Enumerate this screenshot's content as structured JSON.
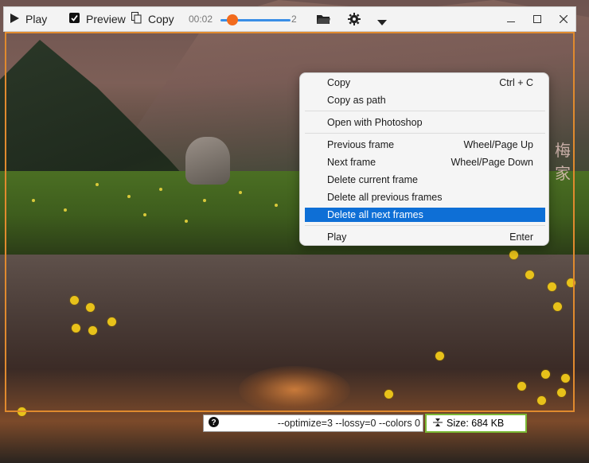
{
  "toolbar": {
    "play_label": "Play",
    "preview_label": "Preview",
    "preview_checked": true,
    "copy_label": "Copy",
    "time_current": "00:02",
    "frame_value": "2",
    "slider_fraction": 0.1,
    "icons": [
      "play-icon",
      "checkbox-icon",
      "copy-icon",
      "folder-icon",
      "gear-icon",
      "dropdown-arrow-icon",
      "minimize-icon",
      "maximize-icon",
      "close-icon"
    ]
  },
  "context_menu": {
    "items": [
      {
        "label": "Copy",
        "shortcut": "Ctrl + C"
      },
      {
        "label": "Copy as path",
        "shortcut": ""
      },
      {
        "label": "Open with Photoshop",
        "shortcut": ""
      },
      {
        "label": "Previous frame",
        "shortcut": "Wheel/Page Up"
      },
      {
        "label": "Next frame",
        "shortcut": "Wheel/Page Down"
      },
      {
        "label": "Delete current frame",
        "shortcut": ""
      },
      {
        "label": "Delete all previous frames",
        "shortcut": ""
      },
      {
        "label": "Delete all next frames",
        "shortcut": "",
        "active": true
      },
      {
        "label": "Play",
        "shortcut": "Enter"
      }
    ]
  },
  "bottom_bar": {
    "params_text": "--optimize=3 --lossy=0 --colors 0",
    "size_text": "Size: 684 KB"
  },
  "watermark_text": "梅 家",
  "colors": {
    "accent": "#0e6fd6",
    "frame_border": "#e08a2e",
    "slider_thumb": "#f26b1d",
    "size_border": "#7ab935"
  }
}
